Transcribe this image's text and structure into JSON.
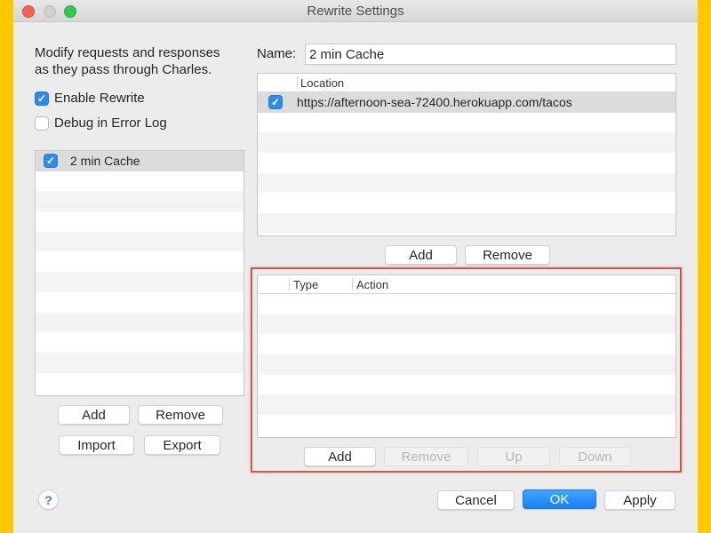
{
  "window": {
    "title": "Rewrite Settings"
  },
  "left_panel": {
    "description_line1": "Modify requests and responses",
    "description_line2": "as they pass through Charles.",
    "enable_rewrite": {
      "label": "Enable Rewrite",
      "checked": true
    },
    "debug_in_error_log": {
      "label": "Debug in Error Log",
      "checked": false
    },
    "sets": [
      {
        "name": "2 min Cache",
        "enabled": true,
        "selected": true
      }
    ],
    "buttons": {
      "add": "Add",
      "remove": "Remove",
      "import": "Import",
      "export": "Export"
    }
  },
  "right_panel": {
    "name_label": "Name:",
    "name_value": "2 min Cache",
    "locations_table": {
      "columns": [
        "",
        "Location"
      ],
      "rows": [
        {
          "enabled": true,
          "location": "https://afternoon-sea-72400.herokuapp.com/tacos"
        }
      ]
    },
    "location_buttons": {
      "add": "Add",
      "remove": "Remove"
    },
    "rules_table": {
      "columns": [
        "",
        "Type",
        "Action"
      ],
      "rows": []
    },
    "rule_buttons": {
      "add": "Add",
      "remove": "Remove",
      "up": "Up",
      "down": "Down",
      "remove_enabled": false,
      "up_enabled": false,
      "down_enabled": false
    }
  },
  "footer": {
    "help": "?",
    "cancel": "Cancel",
    "ok": "OK",
    "apply": "Apply"
  },
  "colors": {
    "accent": "#2D8CEB",
    "highlight_border": "#D0584A",
    "background_frame": "#FEC800"
  }
}
